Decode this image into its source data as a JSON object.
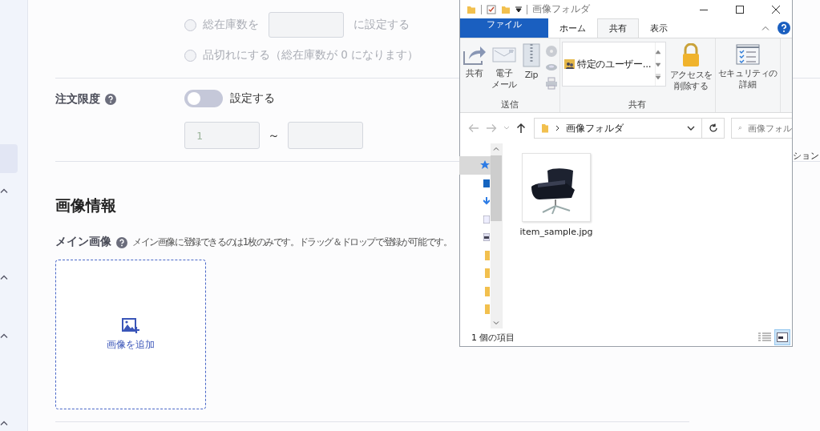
{
  "sidebar": {
    "items": [
      {
        "kind": "blank",
        "selected": true
      },
      {
        "kind": "chevron",
        "selected": false
      },
      {
        "kind": "chevron",
        "selected": false
      },
      {
        "kind": "chevron",
        "selected": false
      },
      {
        "kind": "chevron",
        "selected": false
      }
    ]
  },
  "stock": {
    "options": [
      {
        "kind": "input",
        "label": "総在庫数を",
        "suffix": "に設定する",
        "selected": false,
        "disabled": true
      },
      {
        "kind": "plain",
        "label": "品切れにする（総在庫数が 0 になります）",
        "selected": false,
        "disabled": true
      }
    ]
  },
  "order_limit": {
    "label": "注文限度",
    "toggle": {
      "label": "設定する",
      "on": false
    },
    "range": {
      "min": "1",
      "separator": "～"
    }
  },
  "image_info": {
    "title": "画像情報",
    "main_image": {
      "label": "メイン画像",
      "hint": "メイン画像に登録できるのは1枚のみです。ドラッグ＆ドロップで登録が可能です。",
      "dropzone": "画像を追加"
    }
  },
  "behind_text": "ション",
  "explorer": {
    "title": "画像フォルダ",
    "tabs": [
      {
        "label": "ファイル",
        "kind": "file",
        "selected": false
      },
      {
        "label": "ホーム",
        "kind": "tab",
        "selected": false
      },
      {
        "label": "共有",
        "kind": "tab",
        "selected": true
      },
      {
        "label": "表示",
        "kind": "tab",
        "selected": false
      }
    ],
    "groups": [
      {
        "label": "送信",
        "buttons": [
          {
            "kind": "share",
            "lines": [
              "共有"
            ]
          },
          {
            "kind": "mail",
            "lines": [
              "電子",
              "メール"
            ]
          },
          {
            "kind": "zip",
            "lines": [
              "Zip"
            ]
          },
          {
            "kind": "small-icons"
          }
        ]
      },
      {
        "label": "共有",
        "list_item": "特定のユーザー...",
        "buttons": [
          {
            "kind": "lock",
            "lines": [
              "アクセスを",
              "削除する"
            ]
          }
        ]
      },
      {
        "buttons": [
          {
            "kind": "security",
            "lines": [
              "セキュリティの",
              "詳細"
            ]
          }
        ]
      }
    ],
    "address": "画像フォルダ",
    "search_placeholder": "画像フォル",
    "files": [
      {
        "name": "item_sample.jpg",
        "kind": "picture"
      }
    ],
    "status": "1 個の項目",
    "views": [
      {
        "kind": "details",
        "selected": false
      },
      {
        "kind": "large",
        "selected": true
      }
    ]
  }
}
